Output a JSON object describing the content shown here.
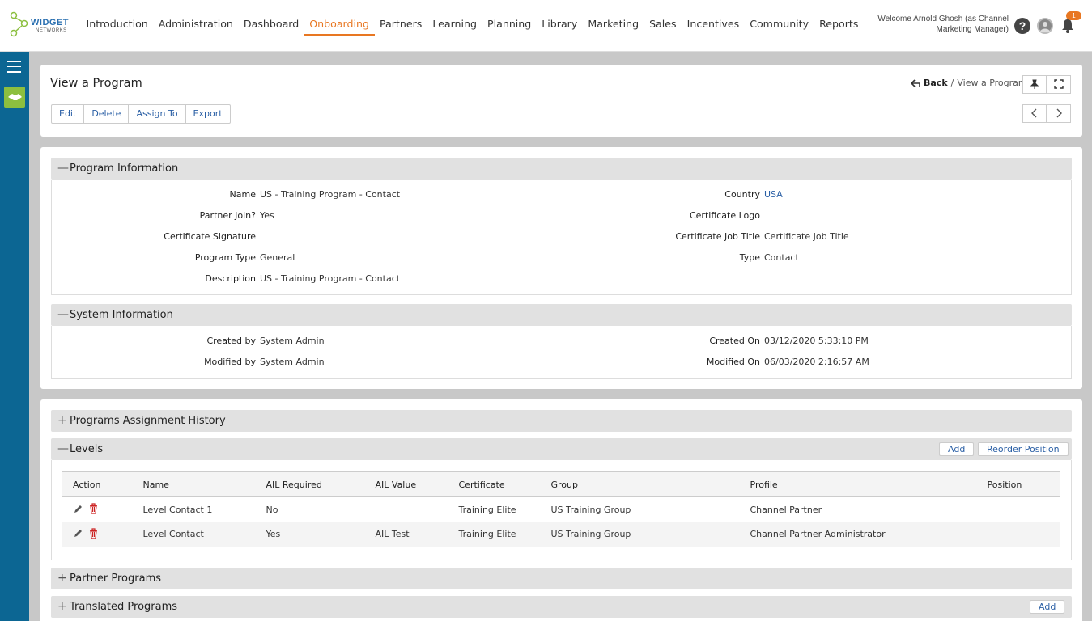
{
  "logo": {
    "line1": "WIDGET",
    "line2": "NETWORKS"
  },
  "nav": [
    "Introduction",
    "Administration",
    "Dashboard",
    "Onboarding",
    "Partners",
    "Learning",
    "Planning",
    "Library",
    "Marketing",
    "Sales",
    "Incentives",
    "Community",
    "Reports"
  ],
  "nav_active": "Onboarding",
  "header": {
    "welcome": "Welcome Arnold Ghosh (as Channel Marketing Manager)",
    "help": "?",
    "notifications": "1"
  },
  "page": {
    "title": "View a Program",
    "back": "Back",
    "separator": "/",
    "crumb": "View a Program"
  },
  "actions": [
    "Edit",
    "Delete",
    "Assign To",
    "Export"
  ],
  "program_info": {
    "title": "Program Information",
    "toggle": "—",
    "name_label": "Name",
    "name": "US - Training Program - Contact",
    "country_label": "Country",
    "country": "USA",
    "partner_join_label": "Partner Join?",
    "partner_join": "Yes",
    "cert_logo_label": "Certificate Logo",
    "cert_sig_label": "Certificate Signature",
    "cert_job_label": "Certificate Job Title",
    "cert_job": "Certificate Job Title",
    "program_type_label": "Program Type",
    "program_type": "General",
    "type_label": "Type",
    "type": "Contact",
    "description_label": "Description",
    "description": "US - Training Program - Contact"
  },
  "system_info": {
    "title": "System Information",
    "toggle": "—",
    "created_by_label": "Created by",
    "created_by": "System Admin",
    "created_on_label": "Created On",
    "created_on": "03/12/2020 5:33:10 PM",
    "modified_by_label": "Modified by",
    "modified_by": "System Admin",
    "modified_on_label": "Modified On",
    "modified_on": "06/03/2020 2:16:57 AM"
  },
  "sections": {
    "assignment_history": "Programs Assignment History",
    "levels": "Levels",
    "partner_programs": "Partner Programs",
    "translated_programs": "Translated Programs",
    "plus": "+",
    "minus": "—"
  },
  "levels": {
    "add": "Add",
    "reorder": "Reorder Position",
    "columns": [
      "Action",
      "Name",
      "AIL Required",
      "AIL Value",
      "Certificate",
      "Group",
      "Profile",
      "Position"
    ],
    "rows": [
      {
        "name": "Level Contact 1",
        "ail_required": "No",
        "ail_value": "",
        "certificate": "Training Elite",
        "group": "US Training Group",
        "profile": "Channel Partner",
        "position": ""
      },
      {
        "name": "Level Contact",
        "ail_required": "Yes",
        "ail_value": "AIL Test",
        "certificate": "Training Elite",
        "group": "US Training Group",
        "profile": "Channel Partner Administrator",
        "position": ""
      }
    ]
  },
  "translated": {
    "add": "Add"
  },
  "colors": {
    "accent": "#e87722",
    "sidebar": "#0c6693",
    "link": "#2a5fa5",
    "section": "#e1e1e1",
    "green": "#8cbf3f",
    "delete": "#cc2222"
  }
}
